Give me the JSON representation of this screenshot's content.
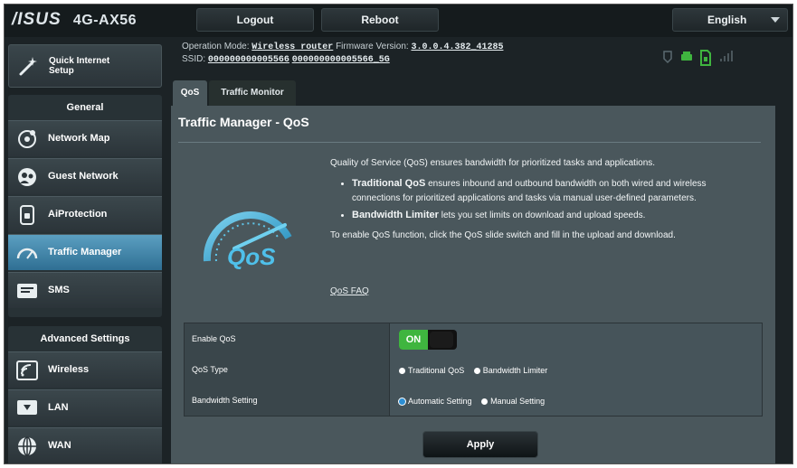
{
  "header": {
    "brand": "/ISUS",
    "model": "4G-AX56",
    "logout_label": "Logout",
    "reboot_label": "Reboot",
    "language": "English"
  },
  "status": {
    "operation_mode_label": "Operation Mode:",
    "operation_mode_value": "Wireless router",
    "firmware_label": "Firmware Version:",
    "firmware_value": "3.0.0.4.382_41285",
    "ssid_label": "SSID:",
    "ssid_24": "000000000005566",
    "ssid_5": "000000000005566_5G"
  },
  "sidebar": {
    "quick_setup": "Quick Internet\nSetup",
    "general_header": "General",
    "general_items": [
      {
        "label": "Network Map",
        "icon": "network-map-icon"
      },
      {
        "label": "Guest Network",
        "icon": "guest-network-icon"
      },
      {
        "label": "AiProtection",
        "icon": "aiprotection-icon"
      },
      {
        "label": "Traffic Manager",
        "icon": "traffic-manager-icon",
        "active": true
      },
      {
        "label": "SMS",
        "icon": "sms-icon"
      }
    ],
    "advanced_header": "Advanced Settings",
    "advanced_items": [
      {
        "label": "Wireless",
        "icon": "wireless-icon"
      },
      {
        "label": "LAN",
        "icon": "lan-icon"
      },
      {
        "label": "WAN",
        "icon": "wan-icon"
      }
    ]
  },
  "tabs": [
    {
      "label": "QoS",
      "active": true
    },
    {
      "label": "Traffic Monitor",
      "active": false
    }
  ],
  "main": {
    "title": "Traffic Manager - QoS",
    "intro": "Quality of Service (QoS) ensures bandwidth for prioritized tasks and applications.",
    "bullet1_title": "Traditional QoS",
    "bullet1_text": " ensures inbound and outbound bandwidth on both wired and wireless connections for prioritized applications and tasks via manual user-defined parameters.",
    "bullet2_title": "Bandwidth Limiter",
    "bullet2_text": " lets you set limits on download and upload speeds.",
    "enable_note": "To enable QoS function, click the QoS slide switch and fill in the upload and download.",
    "faq_link": "QoS FAQ",
    "gauge_text": "QoS"
  },
  "settings": {
    "enable_label": "Enable QoS",
    "enable_value": "ON",
    "type_label": "QoS Type",
    "type_options": [
      "Traditional QoS",
      "Bandwidth Limiter"
    ],
    "bandwidth_label": "Bandwidth Setting",
    "bandwidth_options": [
      "Automatic Setting",
      "Manual Setting"
    ],
    "bandwidth_selected": "Automatic Setting"
  },
  "apply_label": "Apply",
  "colors": {
    "accent": "#3fb53f",
    "active_nav": "#4f93b8",
    "panel": "#4a575c"
  }
}
